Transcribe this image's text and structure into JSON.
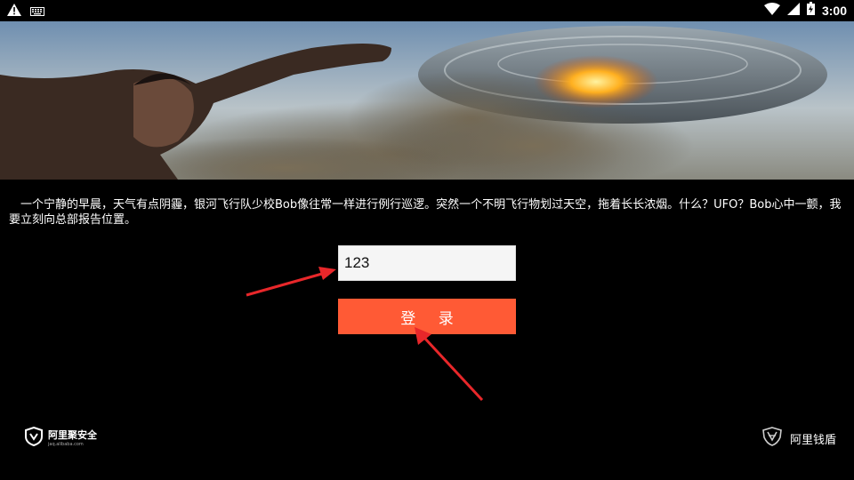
{
  "status_bar": {
    "time": "3:00",
    "left_icons": [
      "warning-icon",
      "keyboard-icon"
    ],
    "right_icons": [
      "wifi-icon",
      "signal-icon",
      "battery-icon"
    ]
  },
  "story_text": "　一个宁静的早晨，天气有点阴霾，银河飞行队少校Bob像往常一样进行例行巡逻。突然一个不明飞行物划过天空，拖着长长浓烟。什么？UFO？Bob心中一颤，我要立刻向总部报告位置。",
  "form": {
    "input_value": "123",
    "login_label": "登 录"
  },
  "footer": {
    "left_brand": "阿里聚安全",
    "left_url": "jaq.alibaba.com",
    "right_brand": "阿里钱盾"
  },
  "colors": {
    "background": "#000000",
    "button": "#ff5a35",
    "arrow": "#e8272a"
  }
}
